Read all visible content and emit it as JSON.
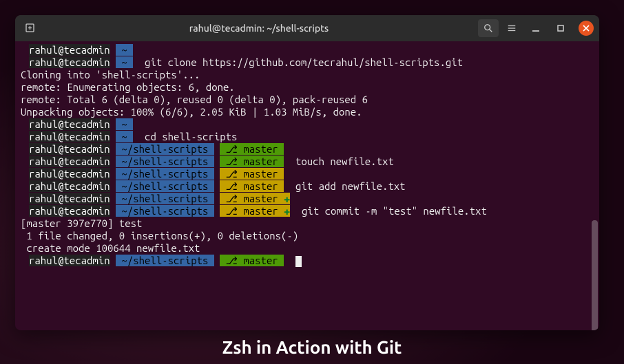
{
  "titlebar": {
    "title": "rahul@tecadmin: ~/shell-scripts"
  },
  "caption": "Zsh in Action with Git",
  "prompt": {
    "user_host": "rahul@tecadmin",
    "home": "~",
    "path": "~/shell-scripts",
    "branch": "master",
    "branch_icon": "⎇"
  },
  "commands": {
    "clone": "git clone https://github.com/tecrahul/shell-scripts.git",
    "cd": "cd shell-scripts",
    "touch": "touch newfile.txt",
    "add": "git add newfile.txt",
    "commit": "git commit -m \"test\" newfile.txt"
  },
  "output": {
    "cloning": "Cloning into 'shell-scripts'...",
    "enumerating": "remote: Enumerating objects: 6, done.",
    "total": "remote: Total 6 (delta 0), reused 0 (delta 0), pack-reused 6",
    "unpacking": "Unpacking objects: 100% (6/6), 2.05 KiB | 1.03 MiB/s, done.",
    "commit_head": "[master 397e770] test",
    "commit_stats": " 1 file changed, 0 insertions(+), 0 deletions(-)",
    "commit_mode": " create mode 100644 newfile.txt"
  }
}
